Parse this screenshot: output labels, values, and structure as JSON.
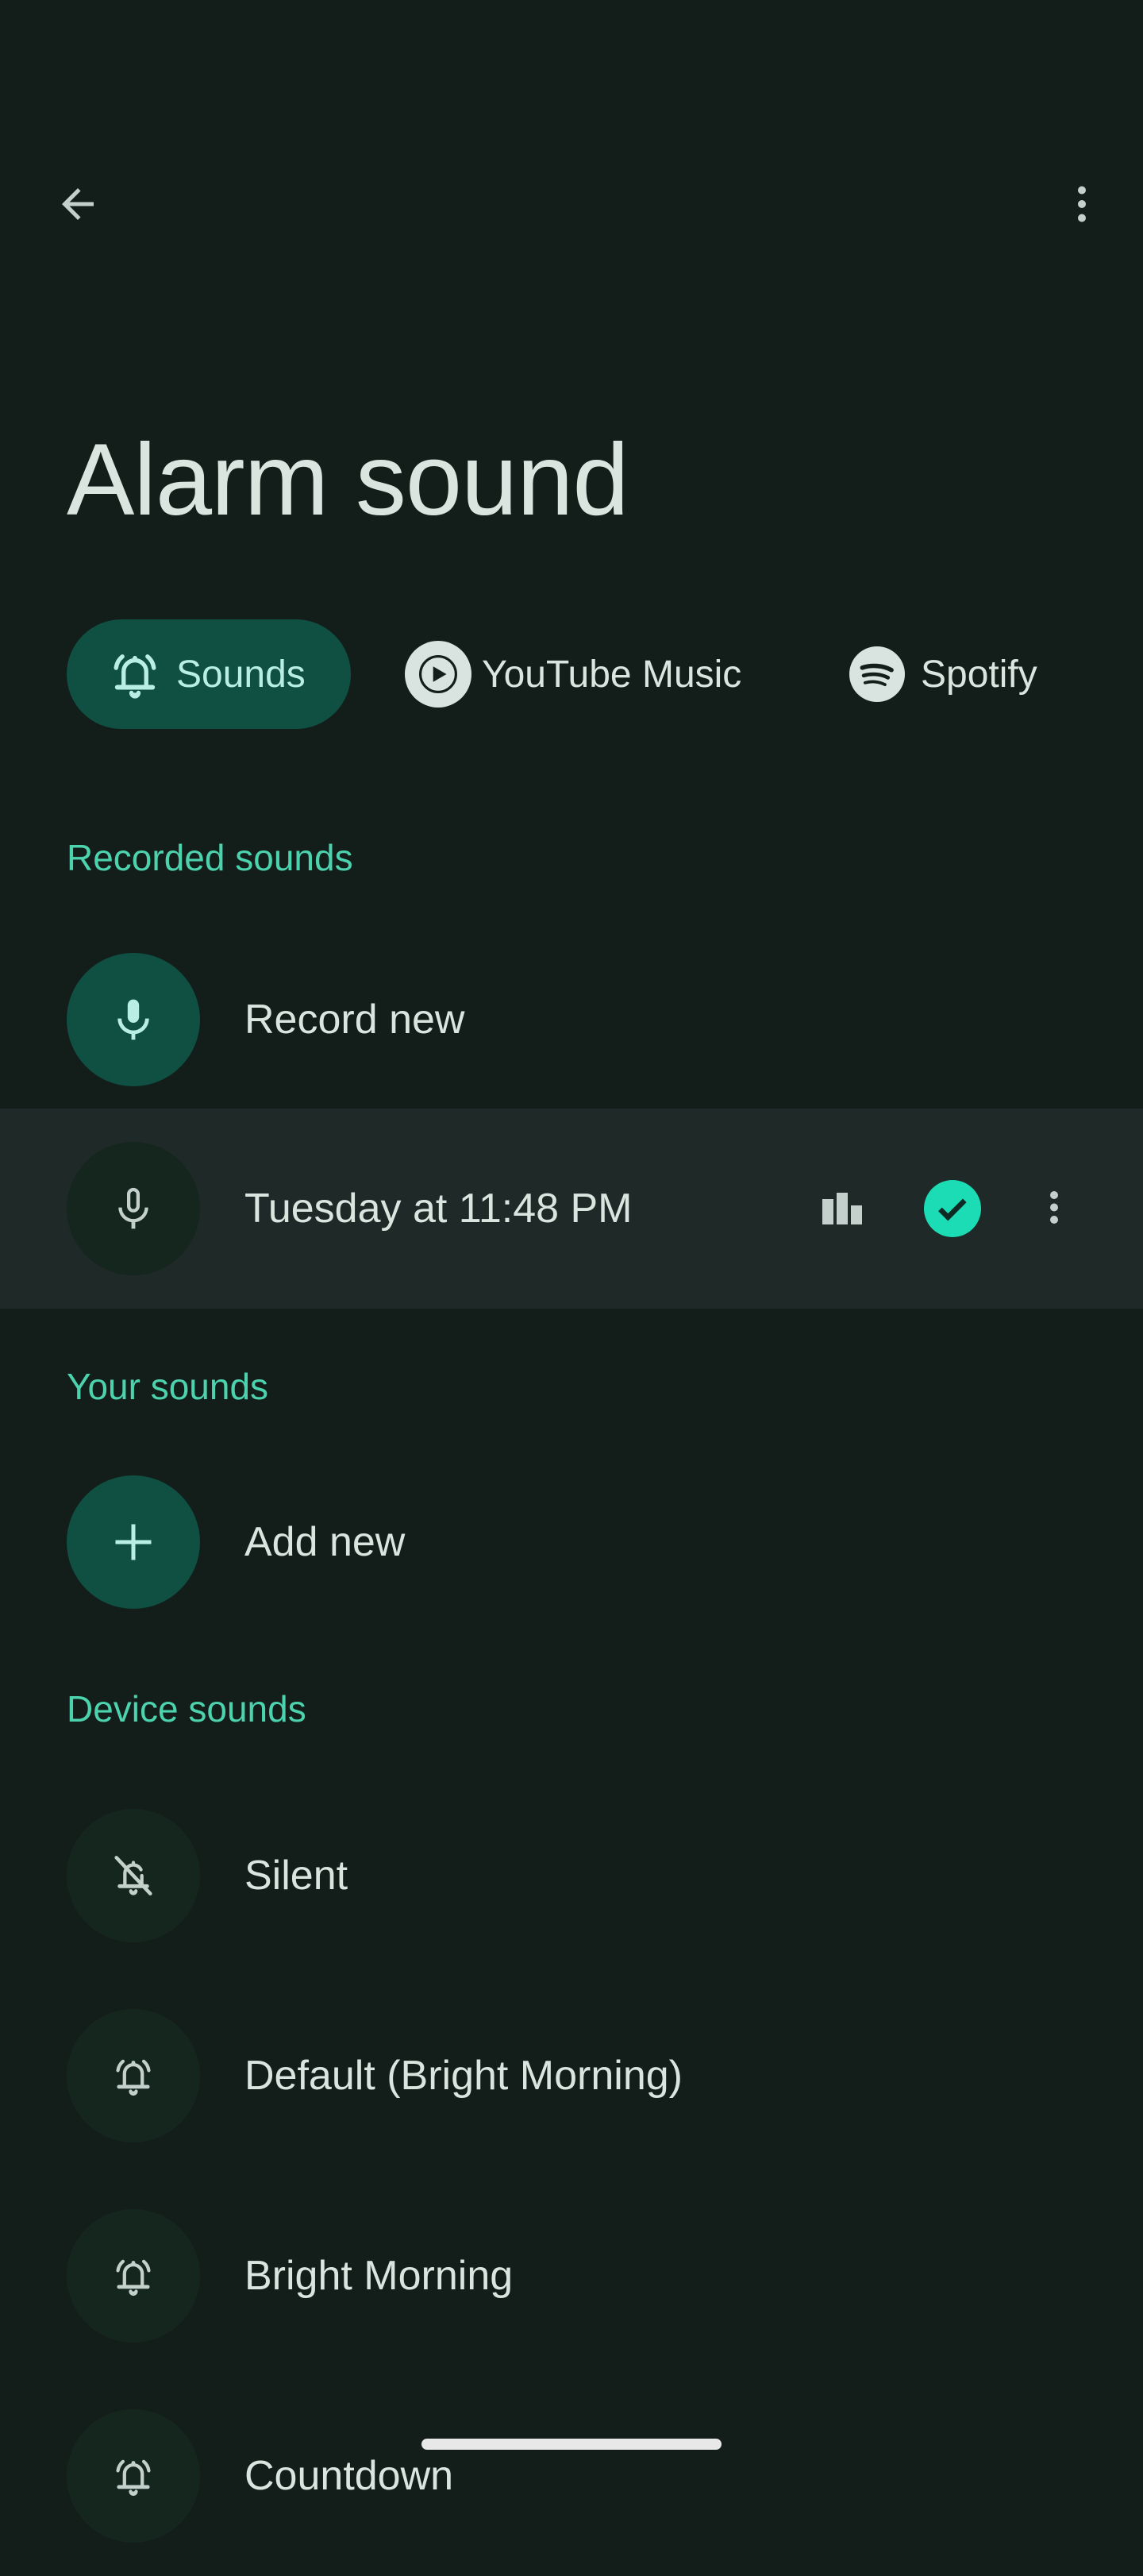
{
  "header": {
    "back_icon": "arrow-back-icon",
    "menu_icon": "more-vert-icon",
    "title": "Alarm sound"
  },
  "tabs": [
    {
      "label": "Sounds",
      "icon": "alarm-bell-icon",
      "selected": true
    },
    {
      "label": "YouTube Music",
      "icon": "youtube-music-icon",
      "selected": false
    },
    {
      "label": "Spotify",
      "icon": "spotify-icon",
      "selected": false
    }
  ],
  "sections": {
    "recorded": {
      "label": "Recorded sounds",
      "items": [
        {
          "label": "Record new",
          "icon": "mic-icon"
        },
        {
          "label": "Tuesday at 11:48 PM",
          "icon": "mic-icon",
          "selected": true,
          "trailing": [
            "equalizer-icon",
            "check-circle-icon",
            "more-vert-icon"
          ]
        }
      ]
    },
    "yours": {
      "label": "Your sounds",
      "items": [
        {
          "label": "Add new",
          "icon": "add-icon"
        }
      ]
    },
    "device": {
      "label": "Device sounds",
      "items": [
        {
          "label": "Silent",
          "icon": "alarm-off-icon"
        },
        {
          "label": "Default (Bright Morning)",
          "icon": "alarm-bell-icon"
        },
        {
          "label": "Bright Morning",
          "icon": "alarm-bell-icon"
        },
        {
          "label": "Countdown",
          "icon": "alarm-bell-icon"
        }
      ]
    }
  },
  "colors": {
    "background": "#131e1b",
    "accent": "#4cd3ae",
    "chip_selected": "#0f5042",
    "check": "#1bdcb5",
    "selected_row": "#1e2928"
  }
}
